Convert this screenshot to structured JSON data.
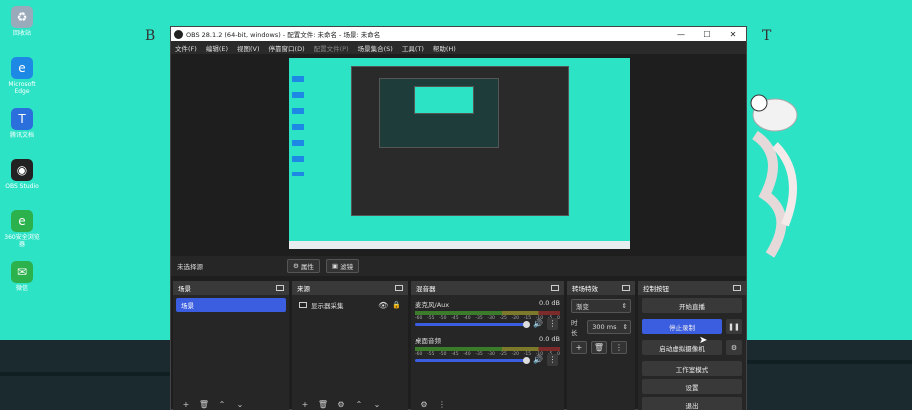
{
  "desktop": {
    "icons": [
      {
        "name": "recycle-bin",
        "label": "回收站",
        "color": "#9ab"
      },
      {
        "name": "microsoft-edge",
        "label": "Microsoft Edge",
        "color": "#1e88e5"
      },
      {
        "name": "tencent-docs",
        "label": "腾讯文档",
        "color": "#2a6fdb"
      },
      {
        "name": "obs-studio",
        "label": "OBS Studio",
        "color": "#222"
      },
      {
        "name": "360-browser",
        "label": "360安全浏览器",
        "color": "#2bb24c"
      },
      {
        "name": "wechat",
        "label": "微信",
        "color": "#2bb24c"
      }
    ],
    "corner_left": "B",
    "corner_right": "T"
  },
  "window": {
    "title": "OBS 28.1.2 (64-bit, windows) - 配置文件: 未命名 - 场景: 未命名",
    "minimize": "—",
    "maximize": "☐",
    "close": "✕"
  },
  "menu": [
    {
      "label": "文件(F)",
      "enabled": true
    },
    {
      "label": "编辑(E)",
      "enabled": true
    },
    {
      "label": "视图(V)",
      "enabled": true
    },
    {
      "label": "停靠窗口(D)",
      "enabled": true
    },
    {
      "label": "配置文件(P)",
      "enabled": false
    },
    {
      "label": "场景集合(S)",
      "enabled": true
    },
    {
      "label": "工具(T)",
      "enabled": true
    },
    {
      "label": "帮助(H)",
      "enabled": true
    }
  ],
  "source_bar": {
    "no_selection": "未选择源",
    "properties": "属性",
    "filters": "滤镜"
  },
  "scenes": {
    "header": "场景",
    "items": [
      "场景"
    ]
  },
  "sources": {
    "header": "来源",
    "items": [
      {
        "label": "显示器采集"
      }
    ]
  },
  "mixer": {
    "header": "混音器",
    "ticks": [
      "-60",
      "-55",
      "-50",
      "-45",
      "-40",
      "-35",
      "-30",
      "-25",
      "-20",
      "-15",
      "-10",
      "-5",
      "0"
    ],
    "tracks": [
      {
        "name": "麦克风/Aux",
        "db": "0.0 dB"
      },
      {
        "name": "桌面音频",
        "db": "0.0 dB"
      }
    ]
  },
  "transitions": {
    "header": "转场特效",
    "selected": "渐变",
    "duration_label": "时长",
    "duration_value": "300 ms"
  },
  "controls": {
    "header": "控制按钮",
    "start_stream": "开始直播",
    "stop_record": "停止录制",
    "virtual_cam": "启动虚拟摄像机",
    "studio_mode": "工作室模式",
    "settings": "设置",
    "exit": "退出"
  },
  "colors": {
    "accent": "#3b5ee0",
    "desktop_bg": "#2de3c6",
    "obs_bg": "#1f1e1f"
  }
}
